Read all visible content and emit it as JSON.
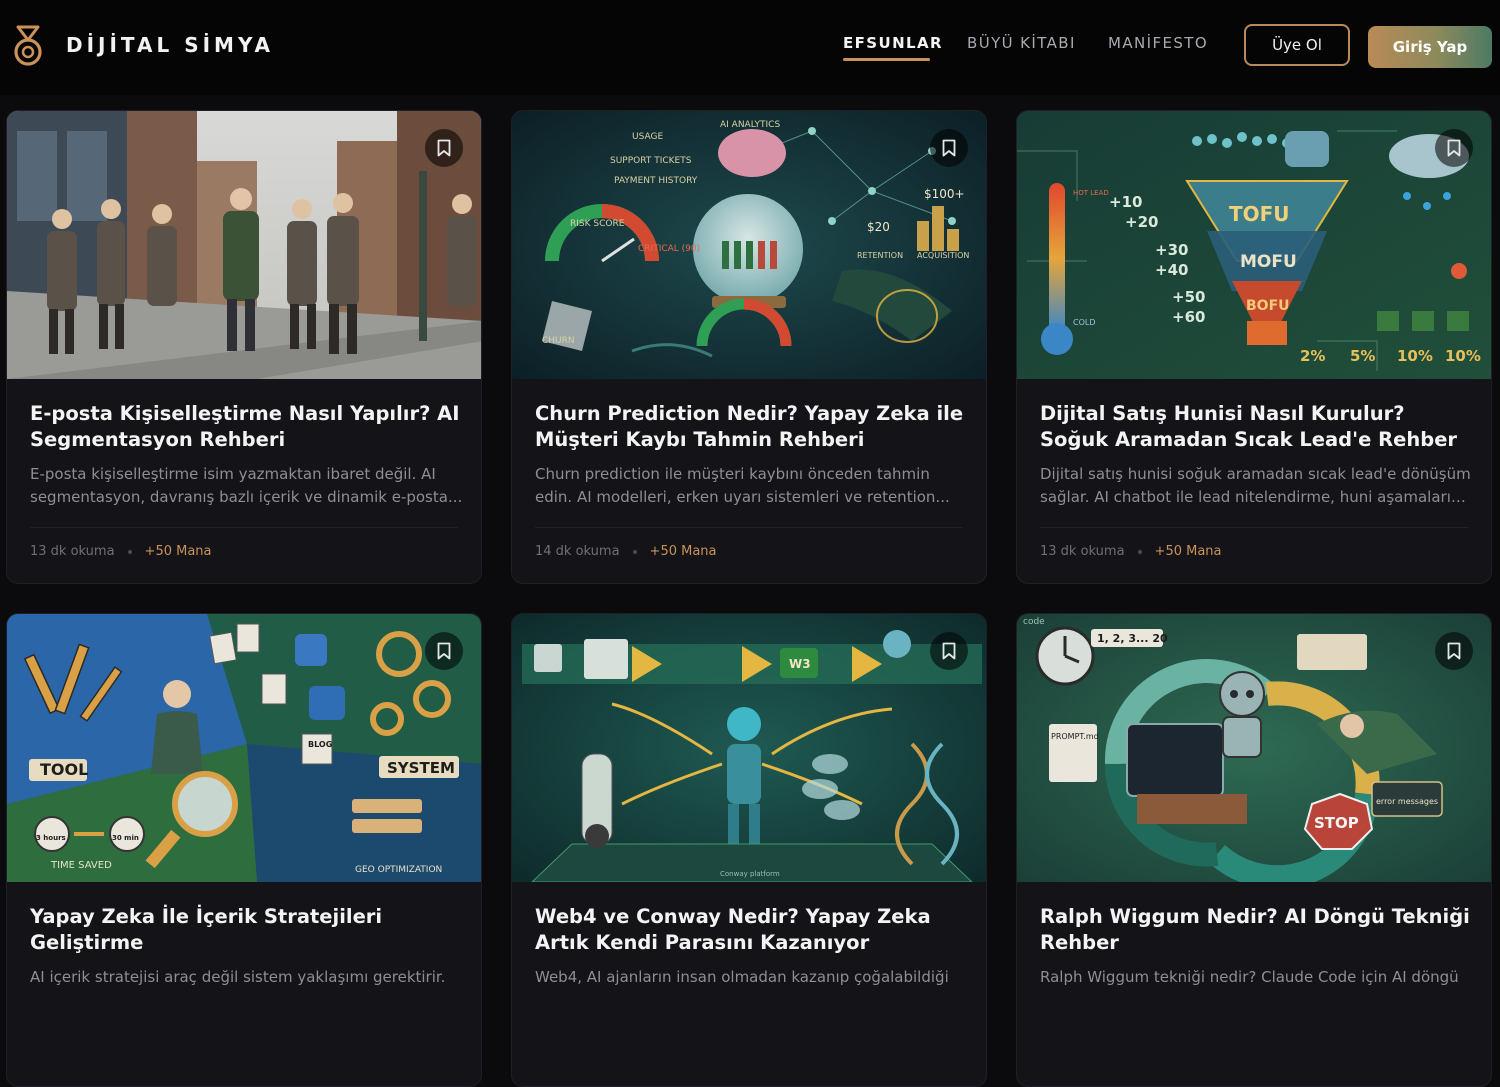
{
  "brand": {
    "name": "DİJİTAL SİMYA"
  },
  "nav": {
    "items": [
      {
        "label": "EFSUNLAR",
        "active": true
      },
      {
        "label": "BÜYÜ KİTABI",
        "active": false
      },
      {
        "label": "MANİFESTO",
        "active": false
      }
    ]
  },
  "header": {
    "register_label": "Üye Ol",
    "login_label": "Giriş Yap"
  },
  "colors": {
    "accent": "#c9925a",
    "background": "#0b0b0e",
    "card": "#131318"
  },
  "cards": [
    {
      "title": "E-posta Kişiselleştirme Nasıl Yapılır? AI Segmentasyon Rehberi",
      "excerpt": "E-posta kişiselleştirme isim yazmaktan ibaret değil. AI segmentasyon, davranış bazlı içerik ve dinamik e-posta...",
      "read_time": "13 dk okuma",
      "mana": "+50 Mana"
    },
    {
      "title": "Churn Prediction Nedir? Yapay Zeka ile Müşteri Kaybı Tahmin Rehberi",
      "excerpt": "Churn prediction ile müşteri kaybını önceden tahmin edin. AI modelleri, erken uyarı sistemleri ve retention...",
      "read_time": "14 dk okuma",
      "mana": "+50 Mana",
      "image_text": {
        "usage": "USAGE",
        "support": "SUPPORT TICKETS",
        "payment": "PAYMENT HISTORY",
        "analytics": "AI ANALYTICS",
        "risk": "RISK SCORE",
        "critical": "CRITICAL (90)",
        "churn": "CHURN",
        "price_high": "$100+",
        "price_low": "$20",
        "retention": "RETENTION",
        "acquisition": "ACQUISITION"
      }
    },
    {
      "title": "Dijital Satış Hunisi Nasıl Kurulur? Soğuk Aramadan Sıcak Lead'e Rehber",
      "excerpt": "Dijital satış hunisi soğuk aramadan sıcak lead'e dönüşüm sağlar. AI chatbot ile lead nitelendirme, huni aşamaları v...",
      "read_time": "13 dk okuma",
      "mana": "+50 Mana",
      "image_text": {
        "tofu": "TOFU",
        "mofu": "MOFU",
        "bofu": "BOFU",
        "hot": "HOT LEAD",
        "cold": "COLD",
        "p1": "+10",
        "p2": "+20",
        "p3": "+30",
        "p4": "+40",
        "p5": "+50",
        "p6": "+60",
        "r1": "2%",
        "r2": "5%",
        "r3": "10%",
        "r4": "10%"
      }
    },
    {
      "title": "Yapay Zeka İle İçerik Stratejileri Geliştirme",
      "excerpt": "AI içerik stratejisi araç değil sistem yaklaşımı gerektirir.",
      "read_time": "",
      "mana": "",
      "image_text": {
        "tool": "TOOL",
        "system": "SYSTEM",
        "time_saved": "TIME SAVED",
        "geo": "GEO OPTIMIZATION",
        "blog": "BLOG",
        "hours": "3 hours",
        "mins": "30 min"
      }
    },
    {
      "title": "Web4 ve Conway Nedir? Yapay Zeka Artık Kendi Parasını Kazanıyor",
      "excerpt": "Web4, AI ajanların insan olmadan kazanıp çoğalabildiği",
      "read_time": "",
      "mana": "",
      "image_text": {
        "w3": "W3",
        "platform": "Conway platform"
      }
    },
    {
      "title": "Ralph Wiggum Nedir? AI Döngü Tekniği Rehber",
      "excerpt": "Ralph Wiggum tekniği nedir? Claude Code için AI döngü",
      "read_time": "",
      "mana": "",
      "image_text": {
        "counter": "1, 2, 3... 20",
        "prompt": "PROMPT.md",
        "stop": "STOP",
        "error": "error messages",
        "code": "code"
      }
    }
  ]
}
